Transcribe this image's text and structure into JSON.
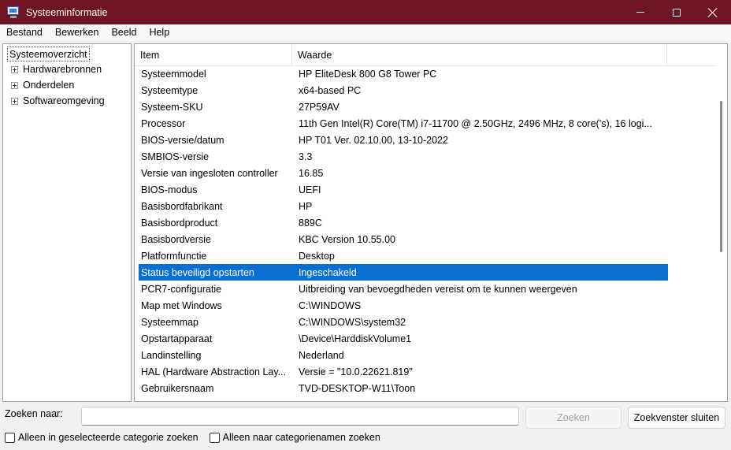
{
  "window": {
    "title": "Systeeminformatie",
    "controls": {
      "minimize": "minimize",
      "maximize": "maximize",
      "close": "close"
    }
  },
  "menu": [
    {
      "label": "Bestand"
    },
    {
      "label": "Bewerken"
    },
    {
      "label": "Beeld"
    },
    {
      "label": "Help"
    }
  ],
  "tree": {
    "root": "Systeemoverzicht",
    "children": [
      "Hardwarebronnen",
      "Onderdelen",
      "Softwareomgeving"
    ]
  },
  "table": {
    "columns": {
      "item": "Item",
      "value": "Waarde"
    },
    "rows": [
      {
        "item": "Systeemmodel",
        "value": "HP EliteDesk 800 G8 Tower PC"
      },
      {
        "item": "Systeemtype",
        "value": "x64-based PC"
      },
      {
        "item": "Systeem-SKU",
        "value": "27P59AV"
      },
      {
        "item": "Processor",
        "value": "11th Gen Intel(R) Core(TM) i7-11700 @ 2.50GHz, 2496 MHz, 8 core('s), 16 logi..."
      },
      {
        "item": "BIOS-versie/datum",
        "value": "HP T01 Ver. 02.10.00, 13-10-2022"
      },
      {
        "item": "SMBIOS-versie",
        "value": "3.3"
      },
      {
        "item": "Versie van ingesloten controller",
        "value": "16.85"
      },
      {
        "item": "BIOS-modus",
        "value": "UEFI"
      },
      {
        "item": "Basisbordfabrikant",
        "value": "HP"
      },
      {
        "item": "Basisbordproduct",
        "value": "889C"
      },
      {
        "item": "Basisbordversie",
        "value": "KBC Version 10.55.00"
      },
      {
        "item": "Platformfunctie",
        "value": "Desktop"
      },
      {
        "item": "Status beveiligd opstarten",
        "value": "Ingeschakeld"
      },
      {
        "item": "PCR7-configuratie",
        "value": "Uitbreiding van bevoegdheden vereist om te kunnen weergeven"
      },
      {
        "item": "Map met Windows",
        "value": "C:\\WINDOWS"
      },
      {
        "item": "Systeemmap",
        "value": "C:\\WINDOWS\\system32"
      },
      {
        "item": "Opstartapparaat",
        "value": "\\Device\\HarddiskVolume1"
      },
      {
        "item": "Landinstelling",
        "value": "Nederland"
      },
      {
        "item": "HAL (Hardware Abstraction Lay...",
        "value": "Versie = \"10.0.22621.819\""
      },
      {
        "item": "Gebruikersnaam",
        "value": "TVD-DESKTOP-W11\\Toon"
      }
    ],
    "selected_index": 12
  },
  "search": {
    "label": "Zoeken naar:",
    "value": "",
    "search_button": "Zoeken",
    "close_button": "Zoekvenster sluiten",
    "check_selected_category": "Alleen in geselecteerde categorie zoeken",
    "check_category_names": "Alleen naar categorienamen zoeken"
  },
  "colors": {
    "titlebar": "#6e1423",
    "selection": "#0a6fd1"
  }
}
